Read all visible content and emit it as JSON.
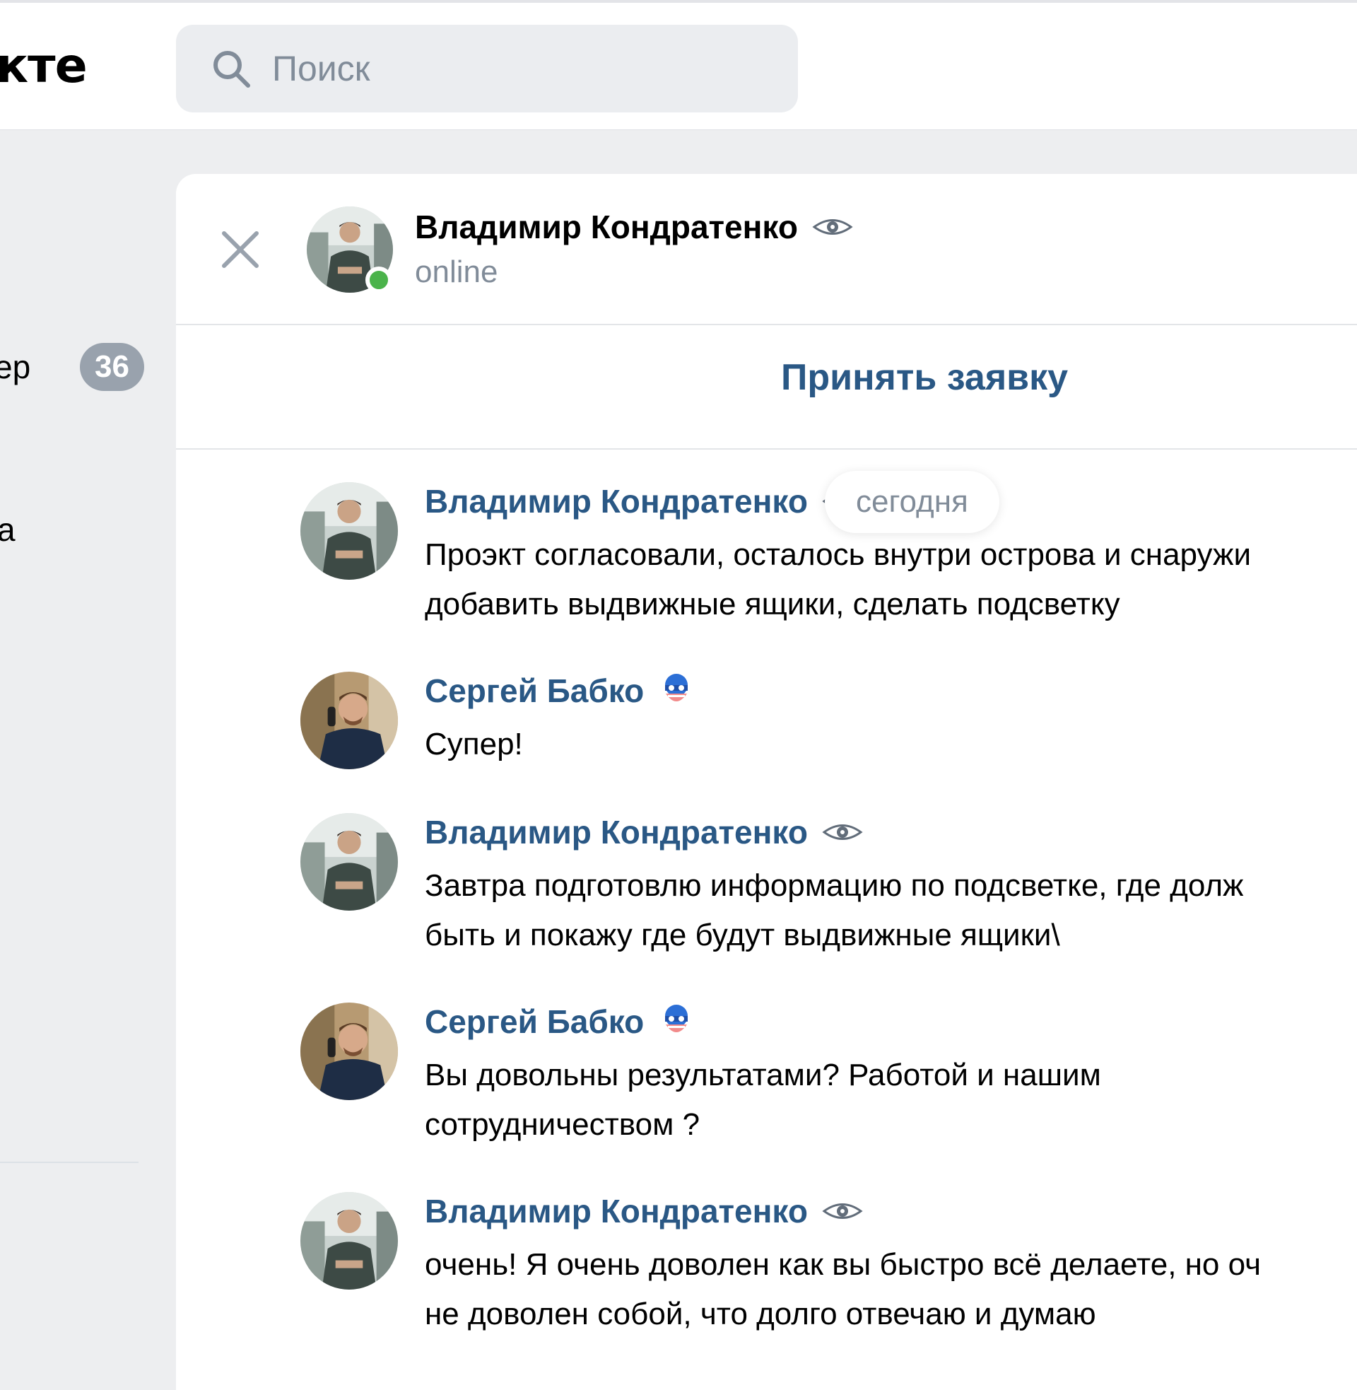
{
  "header": {
    "logo_text": "кте",
    "search_placeholder": "Поиск"
  },
  "sidebar": {
    "item1_fragment": "ер",
    "item1_badge": "36",
    "item2_fragment": "а"
  },
  "chat": {
    "contact_name": "Владимир Кондратенко",
    "contact_status": "online",
    "accept_label": "Принять заявку",
    "date_label": "сегодня",
    "messages": [
      {
        "author": "Владимир Кондратенко",
        "author_icon": "eye-icon",
        "lines": [
          "Проэкт согласовали, осталось внутри острова и снаружи",
          "добавить выдвижные ящики, сделать подсветку"
        ]
      },
      {
        "author": "Сергей Бабко",
        "author_icon": "mask-icon",
        "lines": [
          "Супер!"
        ]
      },
      {
        "author": "Владимир Кондратенко",
        "author_icon": "eye-icon",
        "lines": [
          "Завтра подготовлю информацию по подсветке, где долж",
          "быть и покажу где будут выдвижные ящики\\"
        ]
      },
      {
        "author": "Сергей Бабко",
        "author_icon": "mask-icon",
        "lines": [
          "Вы довольны результатами? Работой и нашим",
          "сотрудничеством ?"
        ]
      },
      {
        "author": "Владимир Кондратенко",
        "author_icon": "eye-icon",
        "lines": [
          "очень! Я очень доволен как вы быстро всё делаете, но оч",
          "не доволен собой, что долго отвечаю и думаю"
        ]
      }
    ]
  },
  "colors": {
    "accent_link": "#2a5885",
    "online": "#4bb34b",
    "muted": "#818c99",
    "background": "#edeef0"
  }
}
